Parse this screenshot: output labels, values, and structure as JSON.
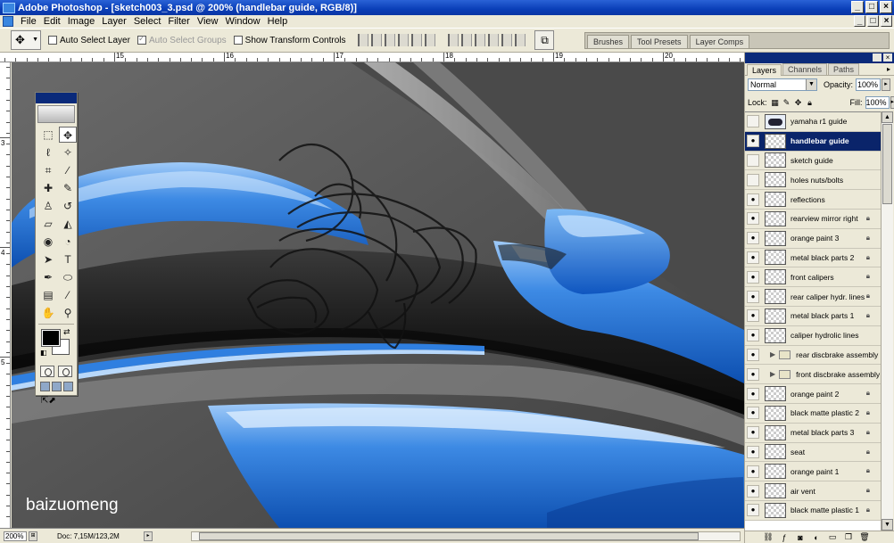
{
  "window": {
    "title": "Adobe Photoshop - [sketch003_3.psd @ 200% (handlebar guide, RGB/8)]",
    "buttons": [
      "_",
      "□",
      "×"
    ]
  },
  "menu": [
    "File",
    "Edit",
    "Image",
    "Layer",
    "Select",
    "Filter",
    "View",
    "Window",
    "Help"
  ],
  "options": {
    "auto_select_layer": "Auto Select Layer",
    "auto_select_groups": "Auto Select Groups",
    "show_transform_controls": "Show Transform Controls",
    "palette_well_tabs": [
      "Brushes",
      "Tool Presets",
      "Layer Comps"
    ]
  },
  "rulers": {
    "top_numbers": [
      "15",
      "16",
      "17",
      "18",
      "19",
      "20"
    ],
    "left_numbers": [
      "3",
      "4",
      "5"
    ]
  },
  "canvas": {
    "watermark": "baizuomeng",
    "colors": {
      "blue": "#1f6fd0",
      "light_blue": "#6aaaf0",
      "dark": "#1a1a1a",
      "gray": "#5a5a5a"
    }
  },
  "layers_panel": {
    "tabs": [
      "Layers",
      "Channels",
      "Paths"
    ],
    "blend_mode": "Normal",
    "opacity_label": "Opacity:",
    "opacity_value": "100%",
    "lock_label": "Lock:",
    "fill_label": "Fill:",
    "fill_value": "100%",
    "layers": [
      {
        "name": "yamaha r1 guide",
        "visible": false,
        "thumb": "moto",
        "locked": false,
        "group": false,
        "selected": false
      },
      {
        "name": "handlebar guide",
        "visible": true,
        "thumb": "checker",
        "locked": false,
        "group": false,
        "selected": true
      },
      {
        "name": "sketch guide",
        "visible": false,
        "thumb": "checker",
        "locked": false,
        "group": false,
        "selected": false
      },
      {
        "name": "holes nuts/bolts",
        "visible": false,
        "thumb": "checker",
        "locked": false,
        "group": false,
        "selected": false
      },
      {
        "name": "reflections",
        "visible": true,
        "thumb": "checker",
        "locked": false,
        "group": false,
        "selected": false
      },
      {
        "name": "rearview mirror right",
        "visible": true,
        "thumb": "checker",
        "locked": true,
        "group": false,
        "selected": false
      },
      {
        "name": "orange paint 3",
        "visible": true,
        "thumb": "checker",
        "locked": true,
        "group": false,
        "selected": false
      },
      {
        "name": "metal black parts 2",
        "visible": true,
        "thumb": "checker",
        "locked": true,
        "group": false,
        "selected": false
      },
      {
        "name": "front calipers",
        "visible": true,
        "thumb": "checker",
        "locked": true,
        "group": false,
        "selected": false
      },
      {
        "name": "rear caliper hydr. lines",
        "visible": true,
        "thumb": "checker",
        "locked": true,
        "group": false,
        "selected": false
      },
      {
        "name": "metal black parts 1",
        "visible": true,
        "thumb": "checker",
        "locked": true,
        "group": false,
        "selected": false
      },
      {
        "name": "caliper hydrolic lines",
        "visible": true,
        "thumb": "checker",
        "locked": false,
        "group": false,
        "selected": false
      },
      {
        "name": "rear discbrake assembly",
        "visible": true,
        "thumb": "none",
        "locked": false,
        "group": true,
        "selected": false
      },
      {
        "name": "front discbrake assembly",
        "visible": true,
        "thumb": "none",
        "locked": false,
        "group": true,
        "selected": false
      },
      {
        "name": "orange paint 2",
        "visible": true,
        "thumb": "checker",
        "locked": true,
        "group": false,
        "selected": false
      },
      {
        "name": "black matte plastic 2",
        "visible": true,
        "thumb": "checker",
        "locked": true,
        "group": false,
        "selected": false
      },
      {
        "name": "metal black parts 3",
        "visible": true,
        "thumb": "checker",
        "locked": true,
        "group": false,
        "selected": false
      },
      {
        "name": "seat",
        "visible": true,
        "thumb": "checker",
        "locked": true,
        "group": false,
        "selected": false
      },
      {
        "name": "orange paint 1",
        "visible": true,
        "thumb": "checker",
        "locked": true,
        "group": false,
        "selected": false
      },
      {
        "name": "air vent",
        "visible": true,
        "thumb": "checker",
        "locked": true,
        "group": false,
        "selected": false
      },
      {
        "name": "black matte plastic 1",
        "visible": true,
        "thumb": "checker",
        "locked": true,
        "group": false,
        "selected": false
      }
    ]
  },
  "status": {
    "zoom": "200%",
    "doc_info": "Doc: 7,15M/123,2M"
  }
}
